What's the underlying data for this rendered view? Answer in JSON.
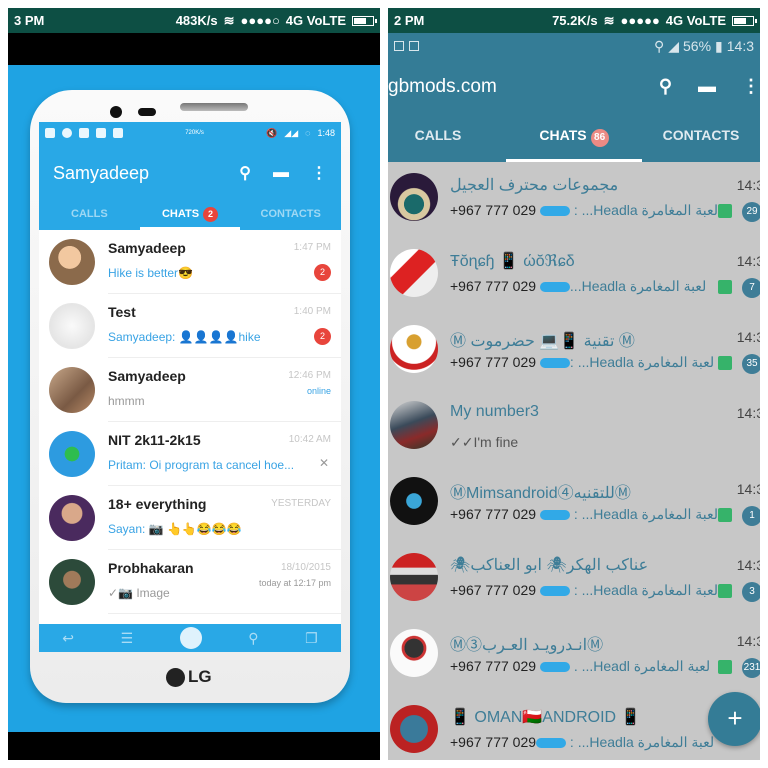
{
  "left": {
    "statusbar": {
      "time": "3 PM",
      "speed": "483K/s",
      "signal": "●●●●○",
      "network": "4G VoLTE"
    },
    "phone": {
      "brand": "LG",
      "statusbar": {
        "speed": "720K/s",
        "time": "1:48"
      },
      "header": {
        "title": "Samyadeep",
        "search_icon": "search-icon",
        "compose_icon": "compose-icon",
        "menu_icon": "more-vert-icon"
      },
      "tabs": [
        {
          "label": "CALLS"
        },
        {
          "label": "CHATS",
          "badge": "2",
          "active": true
        },
        {
          "label": "CONTACTS"
        }
      ],
      "chats": [
        {
          "name": "Samyadeep",
          "message": "Hike is better😎",
          "time": "1:47 PM",
          "unread": "2"
        },
        {
          "name": "Test",
          "sender": "Samyadeep:",
          "message": " 👤👤👤👤hike",
          "time": "1:40 PM",
          "unread": "2"
        },
        {
          "name": "Samyadeep",
          "message": "hmmm",
          "time": "12:46 PM",
          "sub": "online"
        },
        {
          "name": "NIT 2k11-2k15",
          "sender": "Pritam:",
          "message": " Oi program ta cancel hoe...",
          "time": "10:42 AM"
        },
        {
          "name": "18+ everything",
          "sender": "Sayan:",
          "message": " 📷 👆👆😂😂😂",
          "time": "YESTERDAY"
        },
        {
          "name": "Probhakaran",
          "message": "✓📷 Image",
          "time": "18/10/2015",
          "sub": "today at 12:17 pm"
        }
      ],
      "navbar": [
        "back-icon",
        "menu-icon",
        "skull-icon",
        "search-icon",
        "recents-icon"
      ]
    }
  },
  "right": {
    "statusbar": {
      "time": "2 PM",
      "speed": "75.2K/s",
      "signal": "●●●●●",
      "network": "4G VoLTE"
    },
    "substatus": {
      "battery": "56%",
      "time": "14:3"
    },
    "header": {
      "title": "gbmods.com"
    },
    "tabs": [
      {
        "label": "CALLS"
      },
      {
        "label": "CHATS",
        "badge": "86",
        "active": true
      },
      {
        "label": "CONTACTS"
      }
    ],
    "chats": [
      {
        "name": "مجموعات محترف العجيل",
        "phone": "+967 777 029",
        "preview": ": ...Headla لعبة المغامرة",
        "time": "14:3",
        "count": "29"
      },
      {
        "name": "Ŧŏɳɕɧ 📱 ώŏℜɕδ",
        "phone": "+967 777 029",
        "preview": "...Headla لعبة المغامرة",
        "time": "14:3",
        "count": "7"
      },
      {
        "name": "Ⓜ تقنية 📱💻 حضرموت Ⓜ",
        "phone": "+967 777 029",
        "preview": ": ...Headla لعبة المغامرة",
        "time": "14:3",
        "count": "35"
      },
      {
        "name": "My number3",
        "message": "✓✓I'm fine",
        "time": "14:3"
      },
      {
        "name": "ⓂMimsandroid④للتقنيهⓂ",
        "phone": "+967 777 029",
        "preview": ": ...Headla لعبة المغامرة",
        "time": "14:3",
        "count": "1"
      },
      {
        "name": "🕷عناكب الهكر🕷 ابو العناكب",
        "phone": "+967 777 029",
        "preview": ": ...Headla لعبة المغامرة",
        "time": "14:3",
        "count": "3"
      },
      {
        "name": "Ⓜ③انـدرويـد العـربⓂ",
        "phone": "+967 777 029",
        "preview": ". ...Headl لعبة المغامرة",
        "time": "14:3",
        "count": "231"
      },
      {
        "name": "📱 OMAN🇴🇲ANDROID 📱",
        "phone": "+967 777 029",
        "preview": ": ...Headla لعبة المغامرة",
        "time": "",
        "count": ""
      }
    ],
    "fab": {
      "label": "+"
    }
  }
}
